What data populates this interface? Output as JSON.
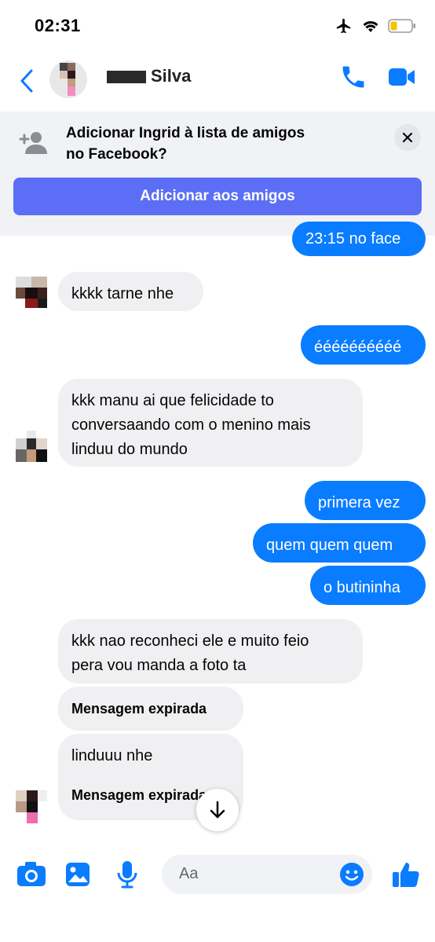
{
  "status_bar": {
    "time": "02:31"
  },
  "header": {
    "name": "Silva"
  },
  "banner": {
    "line1": "Adicionar Ingrid à lista de amigos",
    "line2": "no Facebook?",
    "button": "Adicionar aos amigos"
  },
  "messages": {
    "cut_top": "23:15 no face",
    "m1": "kkkk tarne nhe",
    "m2": "éééééééééé",
    "m3_l1": "kkk manu ai que felicidade to",
    "m3_l2": "conversaando com o menino mais",
    "m3_l3": "linduu do mundo",
    "m4": "primera vez",
    "m5": "quem quem quem",
    "m6": "o butininha",
    "m7_l1": "kkk nao reconheci ele e muito feio",
    "m7_l2": "pera vou manda a foto ta",
    "m8": "Mensagem expirada",
    "m9": "linduuu nhe",
    "m10": "Mensagem expirada"
  },
  "composer": {
    "placeholder": "Aa"
  },
  "colors": {
    "accent": "#0a7cff",
    "banner_button": "#5b6ef5"
  }
}
